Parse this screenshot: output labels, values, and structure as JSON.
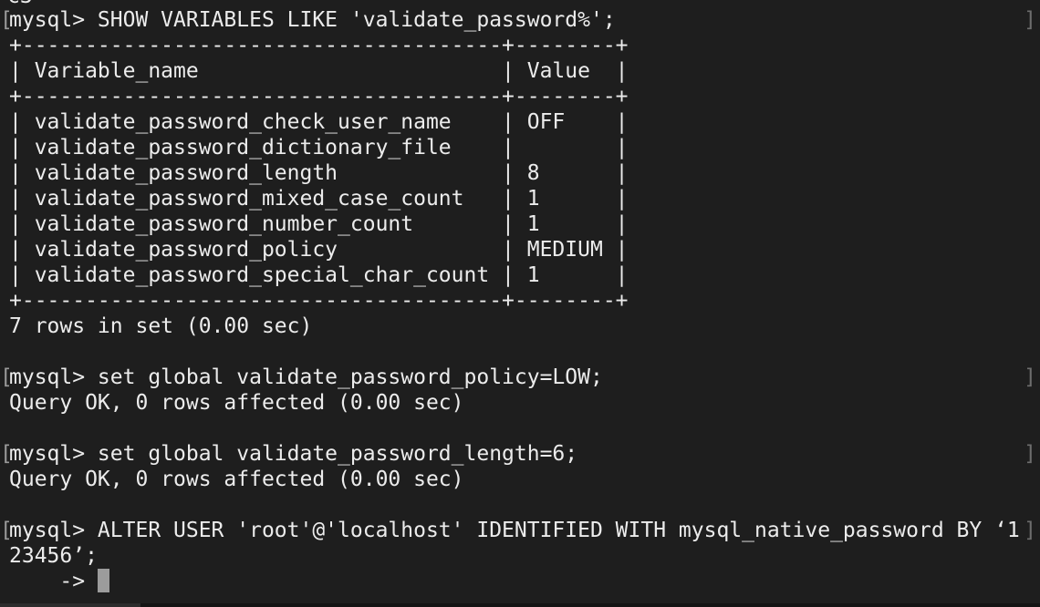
{
  "top_fragment": "c3",
  "lines": [
    {
      "text": "mysql> SHOW VARIABLES LIKE 'validate_password%';",
      "prompt": true
    },
    {
      "text": "+--------------------------------------+--------+"
    },
    {
      "text": "| Variable_name                        | Value  |"
    },
    {
      "text": "+--------------------------------------+--------+"
    },
    {
      "text": "| validate_password_check_user_name    | OFF    |"
    },
    {
      "text": "| validate_password_dictionary_file    |        |"
    },
    {
      "text": "| validate_password_length             | 8      |"
    },
    {
      "text": "| validate_password_mixed_case_count   | 1      |"
    },
    {
      "text": "| validate_password_number_count       | 1      |"
    },
    {
      "text": "| validate_password_policy             | MEDIUM |"
    },
    {
      "text": "| validate_password_special_char_count | 1      |"
    },
    {
      "text": "+--------------------------------------+--------+"
    },
    {
      "text": "7 rows in set (0.00 sec)"
    },
    {
      "text": ""
    },
    {
      "text": "mysql> set global validate_password_policy=LOW;",
      "prompt": true
    },
    {
      "text": "Query OK, 0 rows affected (0.00 sec)"
    },
    {
      "text": ""
    },
    {
      "text": "mysql> set global validate_password_length=6;",
      "prompt": true
    },
    {
      "text": "Query OK, 0 rows affected (0.00 sec)"
    },
    {
      "text": ""
    },
    {
      "text": "mysql> ALTER USER 'root'@'localhost' IDENTIFIED WITH mysql_native_password BY ‘1",
      "prompt": true
    },
    {
      "text": "23456’;"
    },
    {
      "text": "    -> ",
      "cursor": true
    }
  ],
  "bracket_left": "[",
  "bracket_right": "]"
}
